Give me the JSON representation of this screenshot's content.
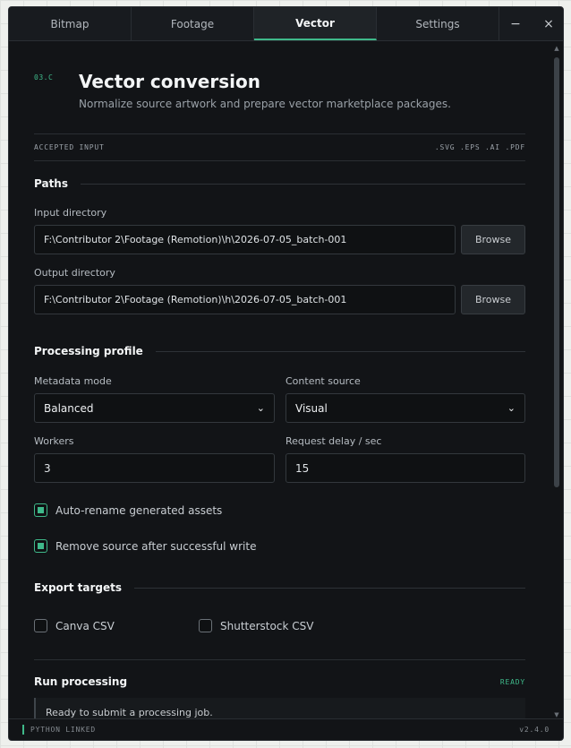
{
  "tabs": [
    {
      "label": "Bitmap",
      "active": false
    },
    {
      "label": "Footage",
      "active": false
    },
    {
      "label": "Vector",
      "active": true
    },
    {
      "label": "Settings",
      "active": false
    }
  ],
  "window_controls": {
    "minimize": "−",
    "close": "×"
  },
  "header": {
    "code": "03.C",
    "title": "Vector conversion",
    "subtitle": "Normalize source artwork and prepare vector marketplace packages."
  },
  "accepted_input": {
    "label": "ACCEPTED INPUT",
    "formats": ".SVG .EPS .AI .PDF"
  },
  "paths": {
    "heading": "Paths",
    "input_label": "Input directory",
    "input_value": "F:\\Contributor 2\\Footage (Remotion)\\h\\2026-07-05_batch-001",
    "output_label": "Output directory",
    "output_value": "F:\\Contributor 2\\Footage (Remotion)\\h\\2026-07-05_batch-001",
    "browse_label": "Browse"
  },
  "profile": {
    "heading": "Processing profile",
    "metadata_mode_label": "Metadata mode",
    "metadata_mode_value": "Balanced",
    "content_source_label": "Content source",
    "content_source_value": "Visual",
    "workers_label": "Workers",
    "workers_value": "3",
    "delay_label": "Request delay / sec",
    "delay_value": "15",
    "auto_rename_label": "Auto-rename generated assets",
    "auto_rename_checked": true,
    "remove_source_label": "Remove source after successful write",
    "remove_source_checked": true
  },
  "export": {
    "heading": "Export targets",
    "canva_label": "Canva CSV",
    "canva_checked": false,
    "shutterstock_label": "Shutterstock CSV",
    "shutterstock_checked": false
  },
  "run": {
    "heading": "Run processing",
    "status": "READY",
    "log_text": "Ready to submit a processing job."
  },
  "statusbar": {
    "left": "PYTHON LINKED",
    "right": "v2.4.0"
  },
  "colors": {
    "accent": "#3fb98a",
    "window_bg": "#121417",
    "page_bg": "#eef0ed"
  }
}
